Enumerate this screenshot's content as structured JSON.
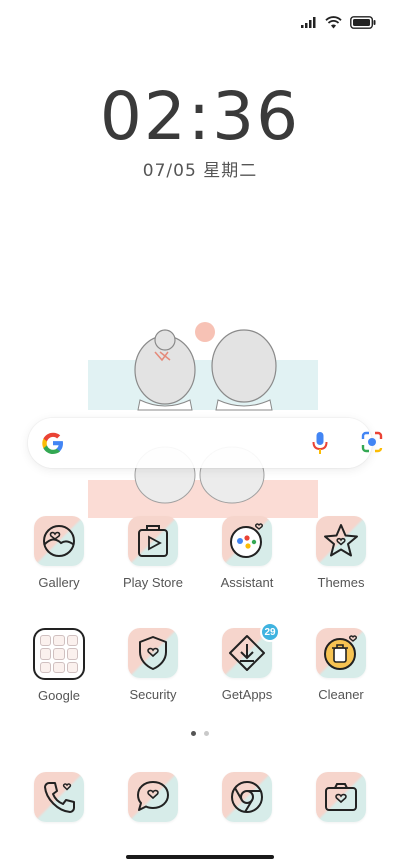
{
  "status_bar": {
    "signal": "signal-icon",
    "wifi": "wifi-icon",
    "battery": "battery-icon"
  },
  "clock": {
    "time": "02:36",
    "date": "07/05 星期二"
  },
  "search_bar": {
    "logo": "google-logo-icon",
    "mic": "mic-icon",
    "lens": "google-lens-icon"
  },
  "apps_row1": [
    {
      "label": "Gallery"
    },
    {
      "label": "Play Store"
    },
    {
      "label": "Assistant"
    },
    {
      "label": "Themes"
    }
  ],
  "apps_row2": [
    {
      "label": "Google"
    },
    {
      "label": "Security"
    },
    {
      "label": "GetApps",
      "badge": "29"
    },
    {
      "label": "Cleaner"
    }
  ],
  "dock": [
    {
      "icon": "phone-icon"
    },
    {
      "icon": "messages-icon"
    },
    {
      "icon": "chrome-icon"
    },
    {
      "icon": "camera-icon"
    }
  ],
  "page_indicator": {
    "pages": 2,
    "current": 1
  },
  "colors": {
    "tile_pink": "#f6d5cc",
    "tile_mint": "#d7ece9",
    "badge": "#3fb3e0"
  }
}
